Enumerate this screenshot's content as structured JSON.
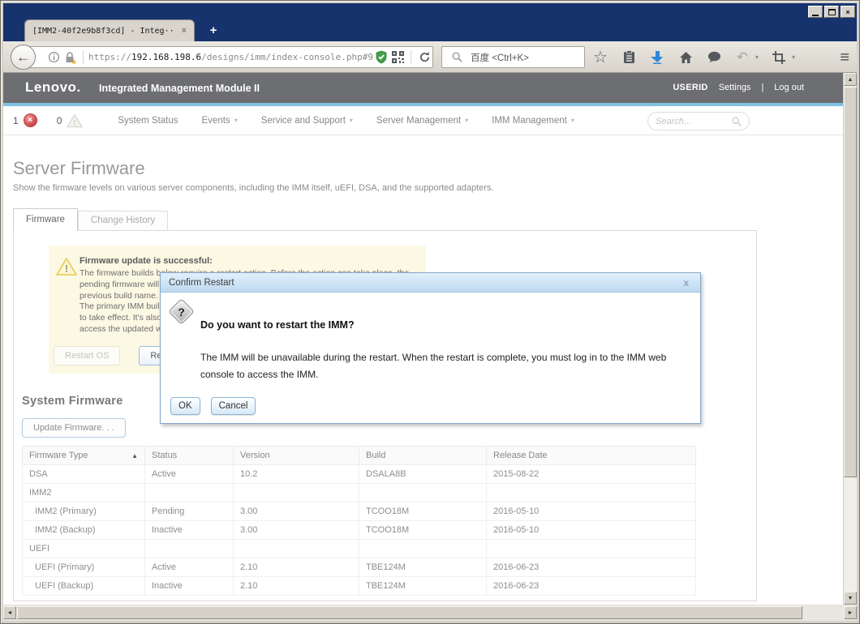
{
  "icons": {
    "back_arrow": "←",
    "tab_close": "×",
    "new_tab": "+",
    "window_close": "×",
    "caret": "▾",
    "sort_asc": "▲",
    "star": "☆",
    "home": "⌂",
    "undo": "↶",
    "hamburger": "≡",
    "error_x": "×",
    "up_arrow": "▲",
    "down_arrow": "▼",
    "left_arrow": "◄",
    "right_arrow": "►",
    "question_mark": "?",
    "exclamation": "!"
  },
  "window": {
    "tab_title": "[IMM2-40f2e9b8f3cd] - Integ··"
  },
  "browser": {
    "url_scheme": "https://",
    "url_host": "192.168.198.6",
    "url_path": "/designs/imm/index-console.php#9",
    "search_placeholder": "百度 <Ctrl+K>"
  },
  "header": {
    "logo": "Lenovo.",
    "app_title": "Integrated Management Module II",
    "user": "USERID",
    "settings": "Settings",
    "divider": "|",
    "logout": "Log out"
  },
  "nav": {
    "error_count": "1",
    "warning_count": "0",
    "items": [
      {
        "label": "System Status"
      },
      {
        "label": "Events"
      },
      {
        "label": "Service and Support"
      },
      {
        "label": "Server Management"
      },
      {
        "label": "IMM Management"
      }
    ],
    "search_placeholder": "Search..."
  },
  "page": {
    "title": "Server Firmware",
    "subtitle": "Show the firmware levels on various server components, including the IMM itself, uEFI, DSA, and the supported adapters.",
    "tabs": [
      {
        "label": "Firmware"
      },
      {
        "label": "Change History"
      }
    ]
  },
  "alert": {
    "title": "Firmware update is successful:",
    "lines": [
      "The firmware builds below require a restart action. Before the action can take place, the",
      "pending firmware will become the active firmware, and the active firmware will become the",
      "previous build name.",
      "The primary IMM build is in pending state. A restart of the IMM is required for the new build",
      "to take effect. It's also recommended to close all opened web console sessions and re-login to",
      "access the updated web pages."
    ],
    "restart_os_label": "Restart OS",
    "restart_imm_label": "Restart IMM"
  },
  "dialog": {
    "title": "Confirm Restart",
    "close": "x",
    "heading": "Do you want to restart the IMM?",
    "body": "The IMM will be unavailable during the restart. When the restart is complete, you must log in to the IMM web console to access the IMM.",
    "ok_label": "OK",
    "cancel_label": "Cancel"
  },
  "firmware": {
    "heading": "System Firmware",
    "update_button_label": "Update Firmware. . .",
    "table": {
      "columns": [
        "Firmware Type",
        "Status",
        "Version",
        "Build",
        "Release Date"
      ],
      "rows": [
        {
          "type": "DSA",
          "status": "Active",
          "version": "10.2",
          "build": "DSALA8B",
          "release_date": "2015-08-22"
        },
        {
          "type": "IMM2",
          "status": "",
          "version": "",
          "build": "",
          "release_date": ""
        },
        {
          "type": "IMM2 (Primary)",
          "status": "Pending",
          "version": "3.00",
          "build": "TCOO18M",
          "release_date": "2016-05-10"
        },
        {
          "type": "IMM2 (Backup)",
          "status": "Inactive",
          "version": "3.00",
          "build": "TCOO18M",
          "release_date": "2016-05-10"
        },
        {
          "type": "UEFI",
          "status": "",
          "version": "",
          "build": "",
          "release_date": ""
        },
        {
          "type": "UEFI (Primary)",
          "status": "Active",
          "version": "2.10",
          "build": "TBE124M",
          "release_date": "2016-06-23"
        },
        {
          "type": "UEFI (Backup)",
          "status": "Inactive",
          "version": "2.10",
          "build": "TBE124M",
          "release_date": "2016-06-23"
        }
      ]
    }
  },
  "colors": {
    "titlebar_navy": "#17336e",
    "header_gray": "#6d6e71",
    "accent_blue_strip": "#7fc2e1",
    "alert_bg": "#fbf8e3",
    "dialog_titlebar": "#bed9f0",
    "error_red": "#cc4747",
    "shield_green": "#3fa044",
    "download_blue": "#2b87d8"
  }
}
